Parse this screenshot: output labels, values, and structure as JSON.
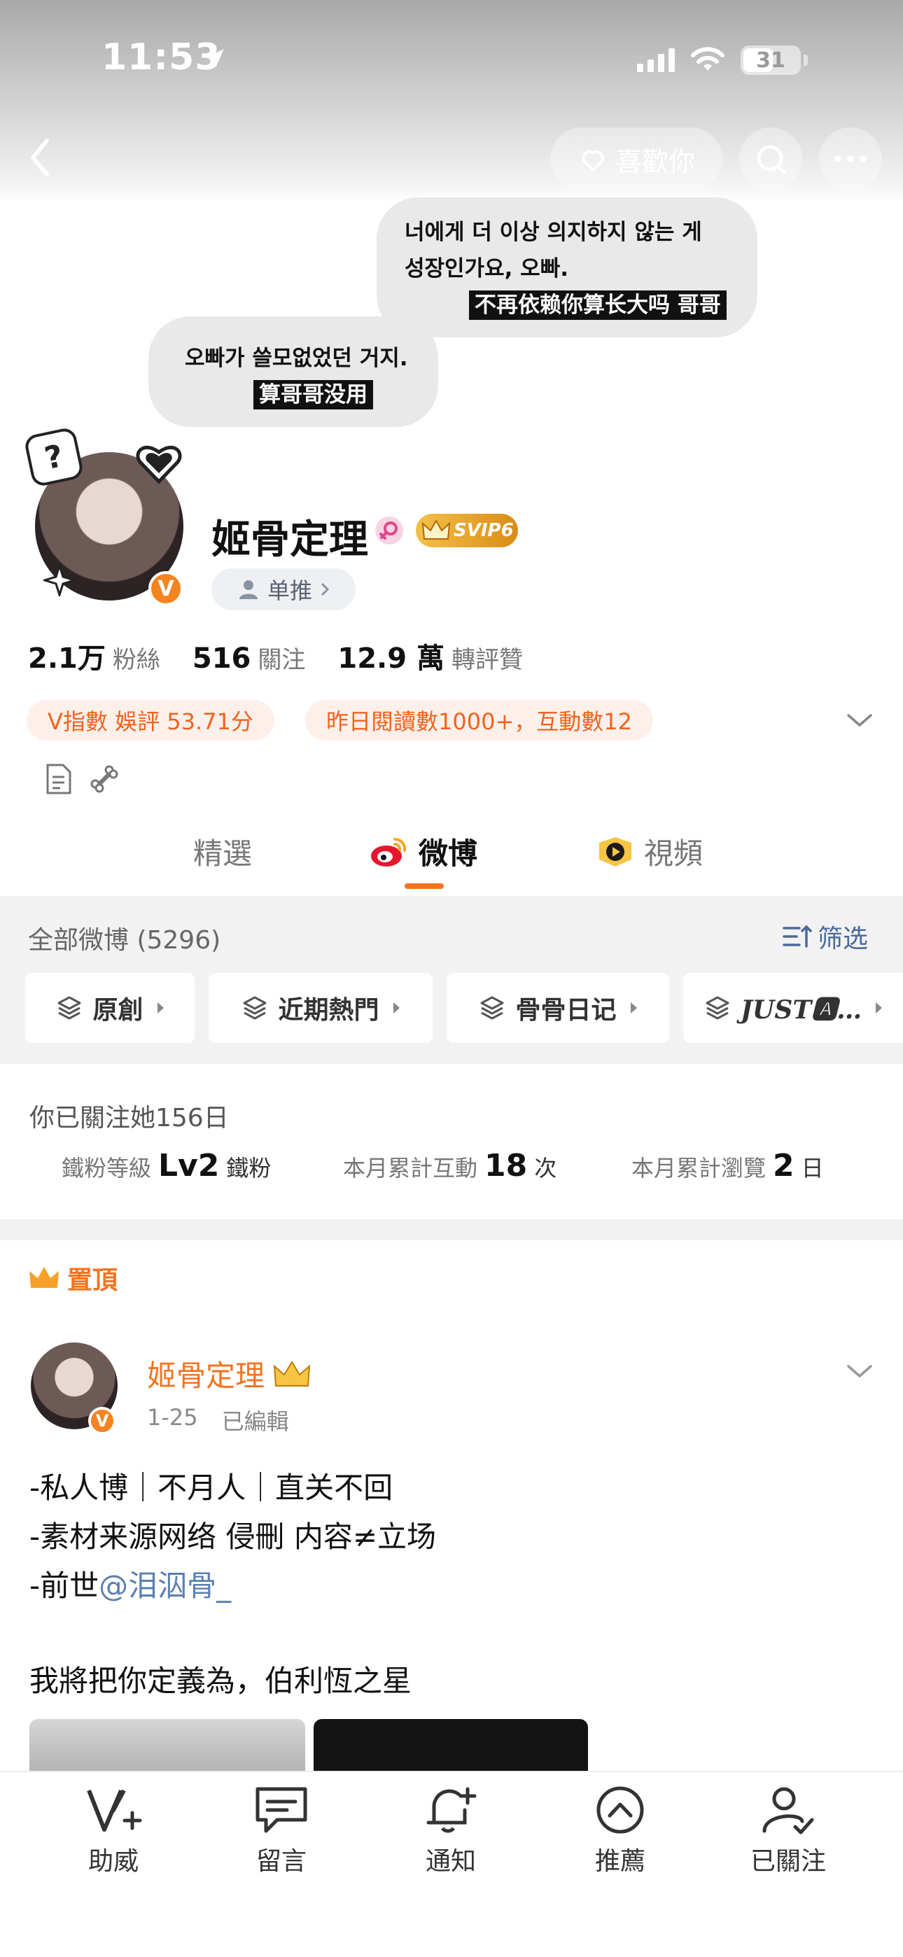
{
  "status_bar": {
    "time": "11:53",
    "battery": "31"
  },
  "header": {
    "like_label": "喜歡你"
  },
  "bubbles": {
    "top_line1": "너에게 더 이상 의지하지 않는 게",
    "top_line2": "성장인가요, 오빠.",
    "top_sub": "不再依赖你算长大吗 哥哥",
    "bottom_line1": "오빠가 쓸모없었던 거지.",
    "bottom_sub": "算哥哥没用"
  },
  "profile": {
    "name": "姬骨定理",
    "vip_label": "SVIP6",
    "verified": "V",
    "tag": "单推",
    "followers_num": "2.1万",
    "followers_label": "粉絲",
    "following_num": "516",
    "following_label": "關注",
    "reposts_num": "12.9 萬",
    "reposts_label": "轉評贊",
    "badge_index": "V指數 娛評 53.71分",
    "badge_reads": "昨日閱讀數1000+，互動數12"
  },
  "tabs": [
    {
      "label": "精選"
    },
    {
      "label": "微博"
    },
    {
      "label": "視頻"
    }
  ],
  "filter": {
    "all_count": "全部微博 (5296)",
    "filter_label": "筛选",
    "chips": [
      "原創",
      "近期熱門",
      "骨骨日记",
      "JUST🅰…"
    ]
  },
  "fan_info": {
    "days": "你已關注她156日",
    "level_label": "鐵粉等級",
    "level_value": "Lv2",
    "level_suffix": "鐵粉",
    "interact_label": "本月累計互動",
    "interact_value": "18",
    "interact_suffix": "次",
    "view_label": "本月累計瀏覽",
    "view_value": "2",
    "view_suffix": "日"
  },
  "post": {
    "pinned_label": "置頂",
    "author": "姬骨定理",
    "date": "1-25",
    "edited": "已編輯",
    "line1": "-私人博｜不月人｜直关不回",
    "line2": "-素材来源网络 侵刪 内容≠立场",
    "line3_prefix": "-前世",
    "line3_mention": "@泪泅骨_",
    "line4": "我將把你定義為，伯利恆之星"
  },
  "bottom_nav": [
    {
      "label": "助威",
      "icon": "v-plus-icon"
    },
    {
      "label": "留言",
      "icon": "message-icon"
    },
    {
      "label": "通知",
      "icon": "bell-plus-icon"
    },
    {
      "label": "推薦",
      "icon": "arrow-up-circle-icon"
    },
    {
      "label": "已關注",
      "icon": "user-check-icon"
    }
  ],
  "colors": {
    "accent": "#f5731f",
    "badge_bg": "#fdf0ea",
    "link": "#5b7fb0",
    "vip_gold": "#e3a21a"
  }
}
